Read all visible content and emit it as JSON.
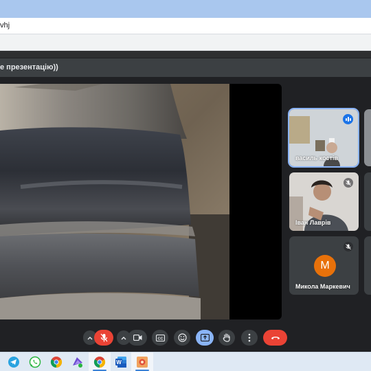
{
  "browser": {
    "address_text": "vhj"
  },
  "presentation": {
    "title_fragment": "е презентацію))"
  },
  "participants": [
    {
      "name": "василь костів",
      "state": "speaking"
    },
    {
      "name": "Іван Лаврів",
      "state": "muted"
    },
    {
      "name": "Микола Маркевич",
      "state": "muted",
      "avatar_letter": "M",
      "avatar_color": "#e8710a"
    }
  ],
  "controls": {
    "microphone": "off",
    "camera": "on",
    "presenting": true,
    "end_call_color": "#ea4335"
  },
  "taskbar": {
    "apps": [
      "telegram-icon",
      "whatsapp-icon",
      "chrome-icon",
      "vpn-icon",
      "chrome-icon",
      "word-icon",
      "app-icon"
    ]
  }
}
